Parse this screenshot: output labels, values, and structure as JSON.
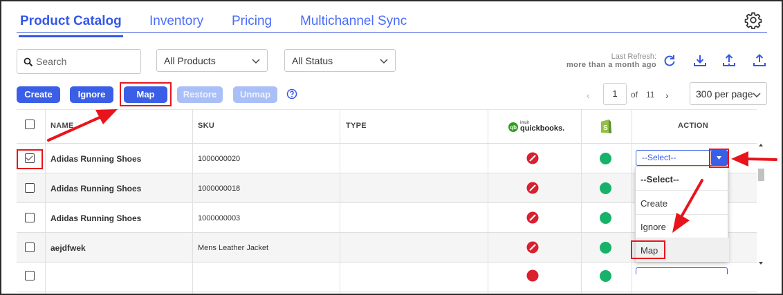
{
  "tabs": [
    {
      "label": "Product Catalog",
      "active": true
    },
    {
      "label": "Inventory"
    },
    {
      "label": "Pricing"
    },
    {
      "label": "Multichannel Sync"
    }
  ],
  "settings_icon": "gear-icon",
  "search": {
    "placeholder": "Search",
    "icon": "search-icon"
  },
  "filters": {
    "products": "All Products",
    "status": "All Status"
  },
  "refresh": {
    "label": "Last Refresh:",
    "value": "more than a month ago"
  },
  "toolbar_icons": [
    "refresh-icon",
    "download-icon",
    "upload-import-icon",
    "upload-icon"
  ],
  "actions": {
    "create": "Create",
    "ignore": "Ignore",
    "map": "Map",
    "restore": "Restore",
    "unmap": "Unmap"
  },
  "pagination": {
    "prev": "‹",
    "page": "1",
    "of": "of",
    "total": "11",
    "next": "›",
    "per_page": "300 per page"
  },
  "table": {
    "headers": {
      "name": "NAME",
      "sku": "SKU",
      "type": "TYPE",
      "action": "ACTION"
    },
    "qb_logo": {
      "small": "intuit",
      "text": "quickbooks."
    },
    "rows": [
      {
        "checked": true,
        "name": "Adidas Running Shoes",
        "sku": "1000000020",
        "type": ""
      },
      {
        "checked": false,
        "name": "Adidas Running Shoes",
        "sku": "1000000018",
        "type": ""
      },
      {
        "checked": false,
        "name": "Adidas Running Shoes",
        "sku": "1000000003",
        "type": ""
      },
      {
        "checked": false,
        "name": "aejdfwek",
        "sku": "Mens Leather Jacket",
        "type": ""
      }
    ]
  },
  "action_select": {
    "value": "--Select--",
    "options": [
      "--Select--",
      "Create",
      "Ignore",
      "Map"
    ],
    "highlighted": "Map"
  },
  "colors": {
    "accent": "#3a5fe6",
    "annotation": "#e8141b",
    "status_ok": "#17b26a",
    "status_blocked": "#d8202f"
  }
}
